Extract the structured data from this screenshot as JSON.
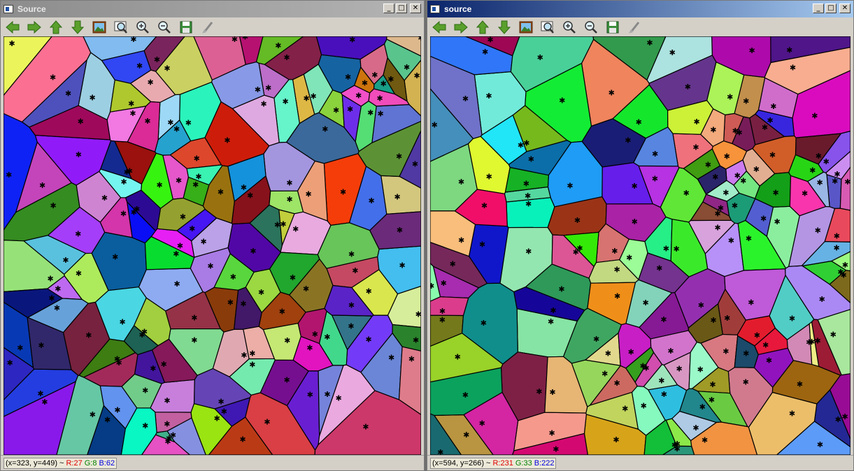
{
  "colors": {
    "red_text": "#e00000",
    "green_text": "#008000",
    "blue_text": "#0000e0"
  },
  "windows": {
    "left": {
      "title": "Source",
      "toolbar": [
        "arrow-left-icon",
        "arrow-right-icon",
        "arrow-up-icon",
        "arrow-down-icon",
        "image-icon",
        "zoom-fit-icon",
        "zoom-in-icon",
        "zoom-out-icon",
        "save-icon",
        "properties-icon"
      ],
      "status": {
        "coords": "(x=323, y=449) ~",
        "r": "R:27",
        "g": "G:8",
        "b": "B:62"
      }
    },
    "right": {
      "title": "source",
      "toolbar": [
        "arrow-left-icon",
        "arrow-right-icon",
        "arrow-up-icon",
        "arrow-down-icon",
        "image-icon",
        "zoom-fit-icon",
        "zoom-in-icon",
        "zoom-out-icon",
        "save-icon",
        "properties-icon"
      ],
      "status": {
        "coords": "(x=594, y=266) ~",
        "r": "R:231",
        "g": "G:33",
        "b": "B:222"
      }
    }
  },
  "title_buttons": {
    "minimize": "_",
    "maximize": "□",
    "close": "✕"
  }
}
